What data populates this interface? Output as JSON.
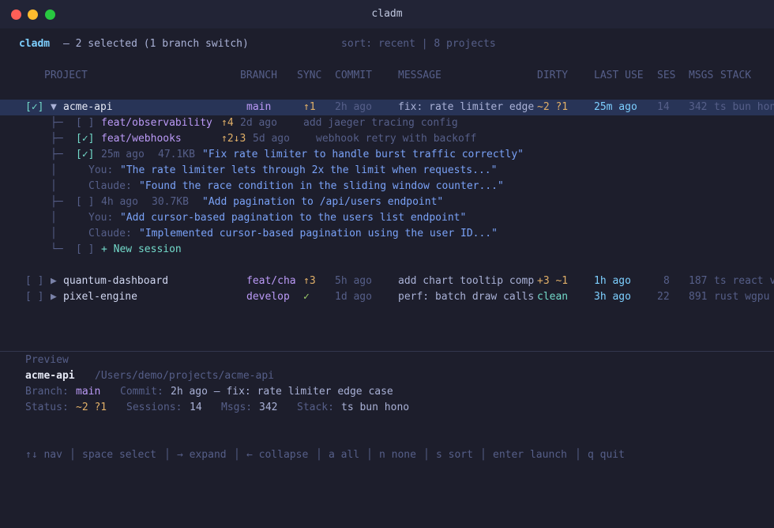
{
  "window": {
    "title": "cladm"
  },
  "header": {
    "app": "cladm",
    "status": "— 2 selected (1 branch switch)",
    "sort_info": "sort: recent | 8 projects"
  },
  "columns": [
    "PROJECT",
    "BRANCH",
    "SYNC",
    "COMMIT",
    "MESSAGE",
    "DIRTY",
    "LAST USE",
    "SES",
    "MSGS",
    "STACK"
  ],
  "projects": [
    {
      "check": "[✓]",
      "arrow": "▼",
      "name": "acme-api",
      "branch": "main",
      "sync": "↑1",
      "commit": "2h ago",
      "message": "fix: rate limiter edge",
      "dirty": "~2 ?1",
      "last_use": "25m ago",
      "sessions": "14",
      "msgs": "342",
      "stack": "ts bun hono"
    },
    {
      "check": "[ ]",
      "arrow": "▶",
      "name": "quantum-dashboard",
      "branch": "feat/cha",
      "sync": "↑3",
      "commit": "5h ago",
      "message": "add chart tooltip comp",
      "dirty": "+3 ~1",
      "last_use": "1h ago",
      "sessions": "8",
      "msgs": "187",
      "stack": "ts react v"
    },
    {
      "check": "[ ]",
      "arrow": "▶",
      "name": "pixel-engine",
      "branch": "develop",
      "sync": "✓",
      "commit": "1d ago",
      "message": "perf: batch draw calls",
      "dirty": "clean",
      "last_use": "3h ago",
      "sessions": "22",
      "msgs": "891",
      "stack": "rust wgpu"
    }
  ],
  "tree": {
    "branches": [
      {
        "prefix": "├─",
        "check": "[ ]",
        "name": "feat/observability",
        "sync": "↑4",
        "when": "2d ago",
        "message": "add jaeger tracing config"
      },
      {
        "prefix": "├─",
        "check": "[✓]",
        "name": "feat/webhooks",
        "sync": "↑2↓3",
        "when": "5d ago",
        "message": "webhook retry with backoff"
      }
    ],
    "sessions": [
      {
        "prefix": "├─",
        "check": "[✓]",
        "when": "25m ago",
        "size": "47.1KB",
        "title": "\"Fix rate limiter to handle burst traffic correctly\"",
        "you_label": "You:",
        "you": "\"The rate limiter lets through 2x the limit when requests...\"",
        "claude_label": "Claude:",
        "claude": "\"Found the race condition in the sliding window counter...\""
      },
      {
        "prefix": "├─",
        "check": "[ ]",
        "when": "4h ago",
        "size": "30.7KB",
        "title": "\"Add pagination to /api/users endpoint\"",
        "you_label": "You:",
        "you": "\"Add cursor-based pagination to the users list endpoint\"",
        "claude_label": "Claude:",
        "claude": "\"Implemented cursor-based pagination using the user ID...\""
      }
    ],
    "vbar": "│",
    "new_session": {
      "prefix": "└─",
      "check": "[ ]",
      "label": "+ New session"
    }
  },
  "preview": {
    "heading": "Preview",
    "name": "acme-api",
    "path": "/Users/demo/projects/acme-api",
    "branch_label": "Branch:",
    "branch": "main",
    "commit_label": "Commit:",
    "commit": "2h ago — fix: rate limiter edge case",
    "status_label": "Status:",
    "status": "~2 ?1",
    "sessions_label": "Sessions:",
    "sessions": "14",
    "msgs_label": "Msgs:",
    "msgs": "342",
    "stack_label": "Stack:",
    "stack": "ts bun hono"
  },
  "footer": {
    "keys": [
      "↑↓ nav",
      "space select",
      "→ expand",
      "← collapse",
      "a all",
      "n none",
      "s sort",
      "enter launch",
      "q quit"
    ],
    "sep": "│"
  }
}
